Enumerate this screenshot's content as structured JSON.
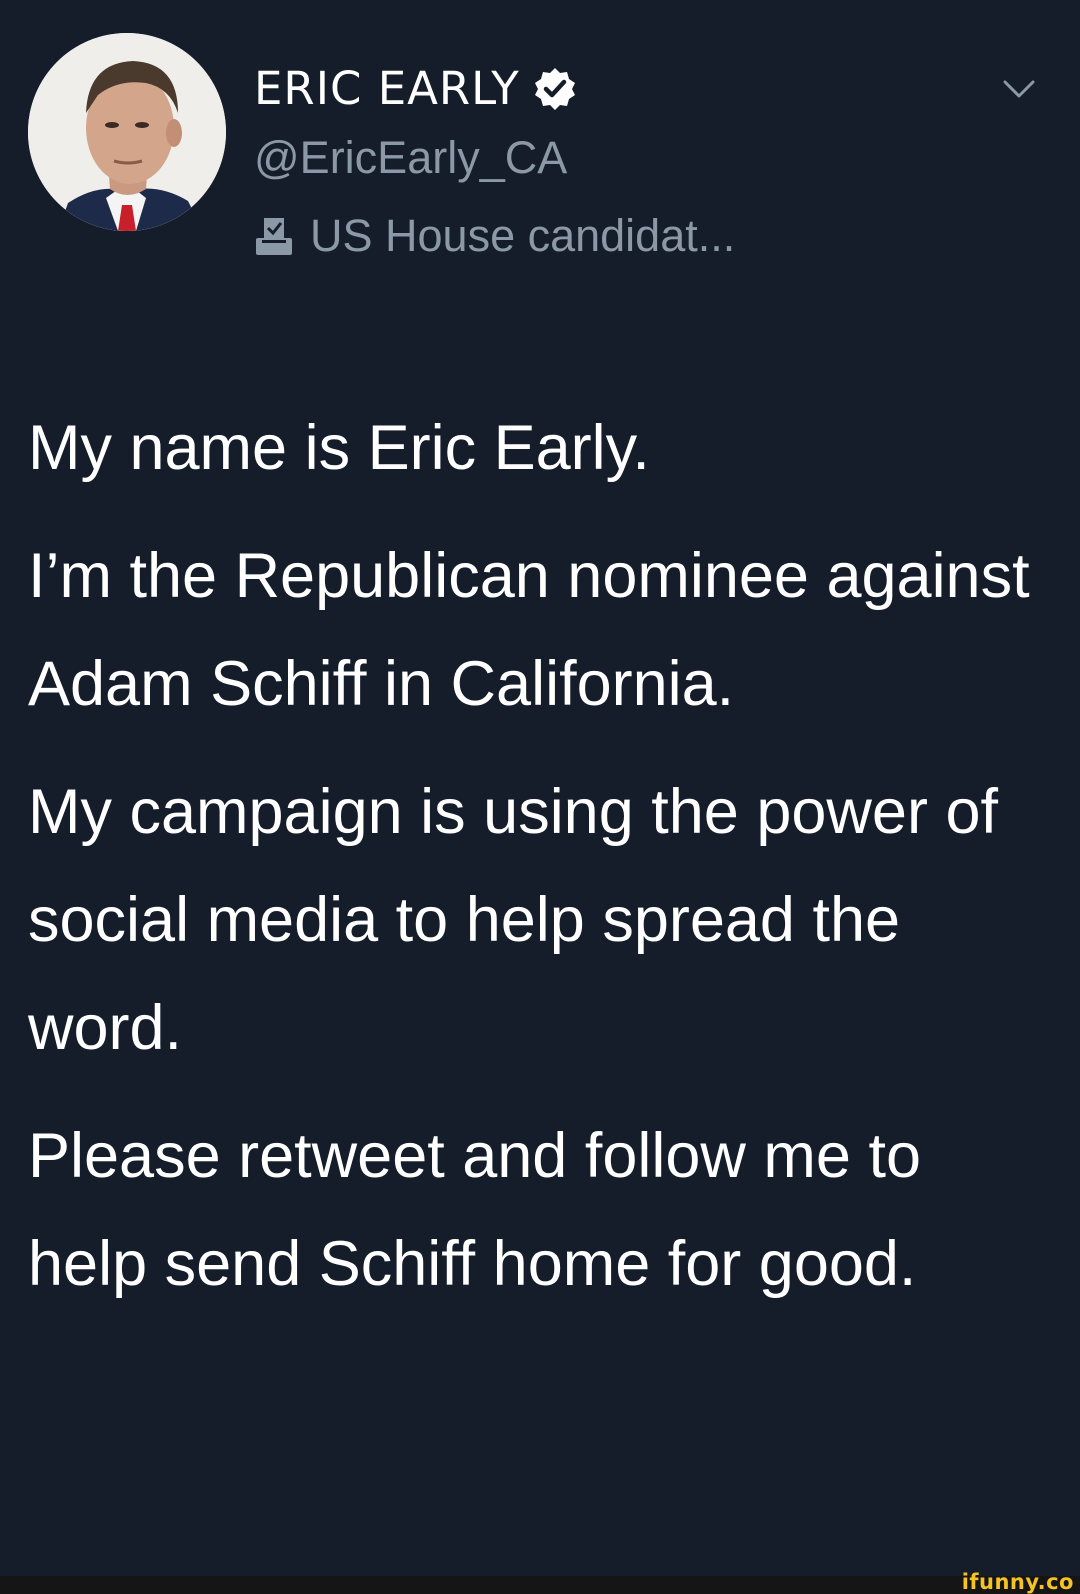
{
  "profile": {
    "display_name": "ERIC EARLY",
    "handle": "@EricEarly_CA",
    "bio": "US House candidat...",
    "verified": true
  },
  "tweet": {
    "paragraphs": [
      "My name is Eric Early.",
      "I’m the Republican nominee against Adam Schiff in California.",
      "My campaign is using the power of social media to help spread the word.",
      "Please retweet and follow me to help send Schiff home for good."
    ]
  },
  "watermark": "ifunny.co",
  "icons": {
    "verified": "verified-badge-icon",
    "bio": "ballot-box-icon",
    "menu": "chevron-down-icon"
  },
  "colors": {
    "background": "#151d2a",
    "text": "#ffffff",
    "secondary_text": "#8b98a5",
    "watermark": "#f6c324"
  }
}
